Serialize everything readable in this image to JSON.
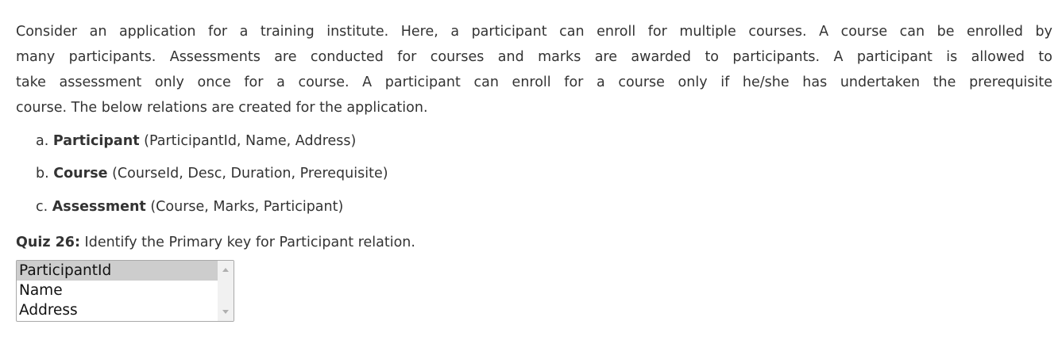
{
  "intro_lines": [
    "Consider an application for a training institute. Here, a participant can enroll for multiple courses. A course can be enrolled by",
    "many participants. Assessments are conducted for courses and marks are awarded to participants. A participant is allowed to",
    "take assessment only once for a course. A participant can enroll for a course only if he/she has undertaken the prerequisite",
    "course. The below relations are created for the application."
  ],
  "relations": [
    {
      "marker": "a.",
      "name": "Participant",
      "attrs": "(ParticipantId, Name, Address)"
    },
    {
      "marker": "b.",
      "name": "Course",
      "attrs": "(CourseId, Desc, Duration, Prerequisite)"
    },
    {
      "marker": "c.",
      "name": "Assessment",
      "attrs": "(Course, Marks, Participant)"
    }
  ],
  "quiz": {
    "label": "Quiz 26:",
    "question": "Identify the Primary key for Participant relation."
  },
  "answer_select": {
    "options": [
      "ParticipantId",
      "Name",
      "Address"
    ],
    "selected": "ParticipantId"
  }
}
